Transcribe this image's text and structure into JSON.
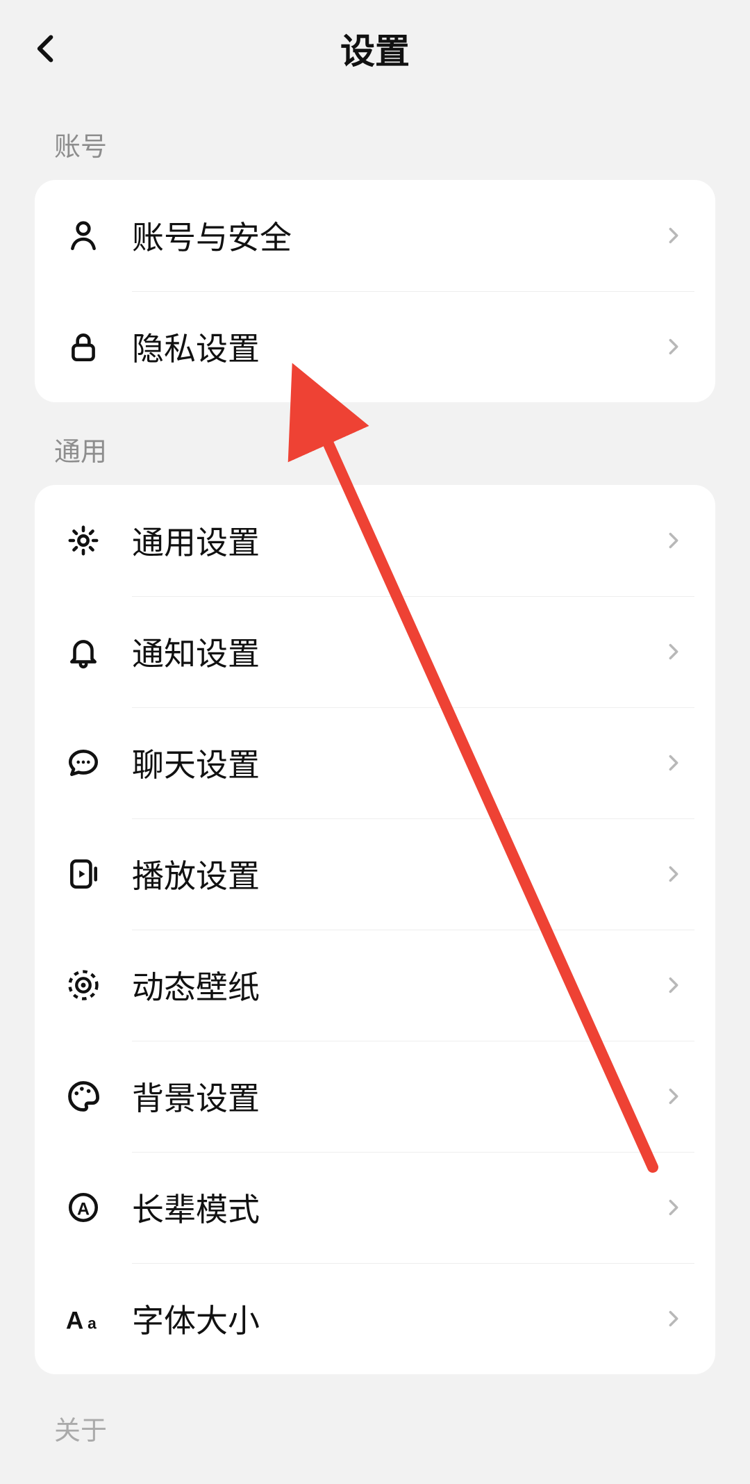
{
  "header": {
    "title": "设置"
  },
  "sections": {
    "account": {
      "label": "账号",
      "items": [
        {
          "label": "账号与安全"
        },
        {
          "label": "隐私设置"
        }
      ]
    },
    "general": {
      "label": "通用",
      "items": [
        {
          "label": "通用设置"
        },
        {
          "label": "通知设置"
        },
        {
          "label": "聊天设置"
        },
        {
          "label": "播放设置"
        },
        {
          "label": "动态壁纸"
        },
        {
          "label": "背景设置"
        },
        {
          "label": "长辈模式"
        },
        {
          "label": "字体大小"
        }
      ]
    },
    "about": {
      "label": "关于"
    }
  },
  "colors": {
    "arrow": "#ee4234"
  }
}
